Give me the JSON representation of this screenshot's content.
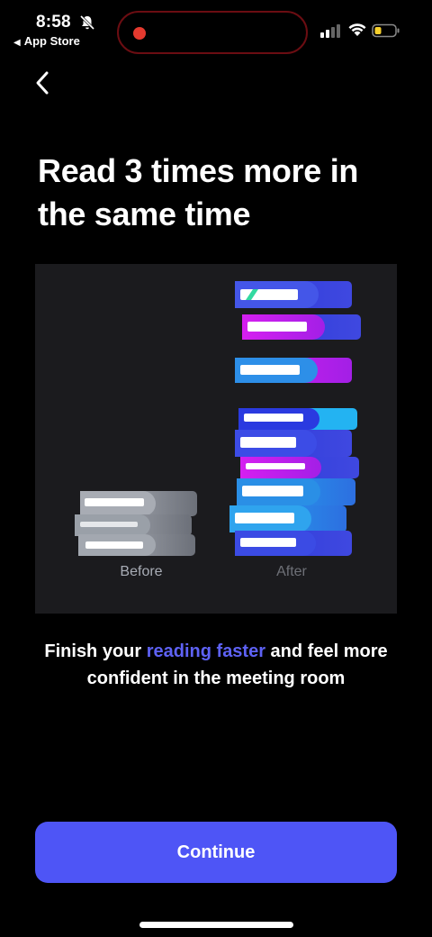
{
  "status_bar": {
    "time": "8:58",
    "back_app": "App Store",
    "bell_icon": "bell-slash-icon",
    "signal_icon": "cellular-signal-icon",
    "wifi_icon": "wifi-icon",
    "battery_icon": "battery-icon",
    "battery_color": "#f7d02c",
    "recording_color": "#e53a2f"
  },
  "nav": {
    "back_icon": "chevron-left-icon"
  },
  "title": "Read 3 times more in the same time",
  "illustration": {
    "before_label": "Before",
    "after_label": "After",
    "colors": {
      "before_books": "#8c9099",
      "blue": "#3b46d8",
      "magenta": "#d21cf0",
      "cyan": "#23a8f0"
    }
  },
  "subtitle": {
    "part1": "Finish your ",
    "highlight": "reading faster",
    "part2": " and feel more confident in the meeting room",
    "highlight_color": "#5e62f5"
  },
  "continue_button": {
    "label": "Continue",
    "color": "#4e55f6"
  }
}
